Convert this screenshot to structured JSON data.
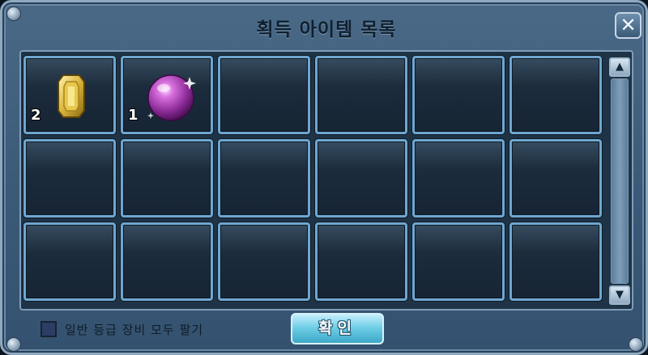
{
  "window": {
    "title": "획득 아이템 목록",
    "close_label": "✕"
  },
  "slots": [
    {
      "item": "gold-gem",
      "count": "2"
    },
    {
      "item": "purple-orb",
      "count": "1"
    },
    {
      "item": "",
      "count": ""
    },
    {
      "item": "",
      "count": ""
    },
    {
      "item": "",
      "count": ""
    },
    {
      "item": "",
      "count": ""
    },
    {
      "item": "",
      "count": ""
    },
    {
      "item": "",
      "count": ""
    },
    {
      "item": "",
      "count": ""
    },
    {
      "item": "",
      "count": ""
    },
    {
      "item": "",
      "count": ""
    },
    {
      "item": "",
      "count": ""
    },
    {
      "item": "",
      "count": ""
    },
    {
      "item": "",
      "count": ""
    },
    {
      "item": "",
      "count": ""
    },
    {
      "item": "",
      "count": ""
    },
    {
      "item": "",
      "count": ""
    },
    {
      "item": "",
      "count": ""
    }
  ],
  "scrollbar": {
    "up_label": "▲",
    "down_label": "▼"
  },
  "footer": {
    "checkbox_label": "일반 등급 장비 모두 팔기",
    "checkbox_checked": false,
    "confirm_label": "확인"
  },
  "colors": {
    "window_bg": "#3c5b79",
    "slot_border": "#6fa6cf",
    "confirm_bg": "#6ccde6"
  }
}
